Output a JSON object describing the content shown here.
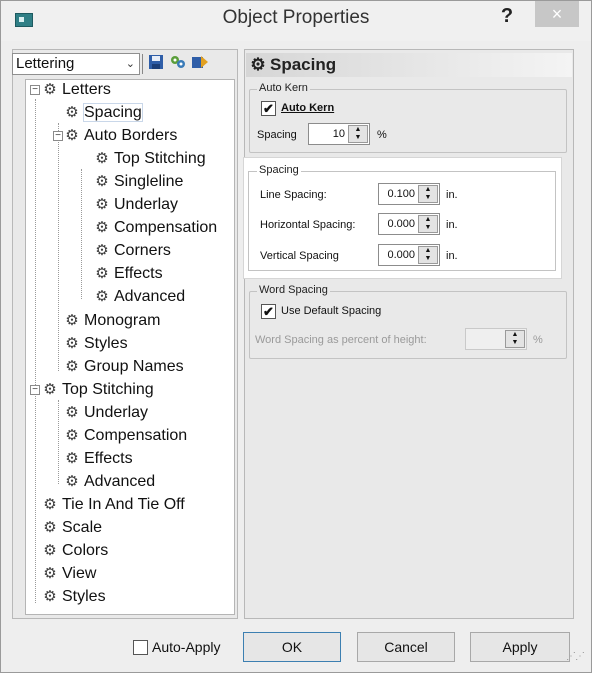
{
  "window": {
    "title": "Object Properties",
    "help_label": "?",
    "close_label": "×"
  },
  "toolbar": {
    "combo_value": "Lettering",
    "combo_arrow": "⌄",
    "tool1_icon": "save-icon",
    "tool2_icon": "gear-group-icon",
    "tool3_icon": "export-icon"
  },
  "tree": {
    "items": [
      {
        "label": "Letters"
      },
      {
        "label": "Spacing"
      },
      {
        "label": "Auto Borders"
      },
      {
        "label": "Top Stitching"
      },
      {
        "label": "Singleline"
      },
      {
        "label": "Underlay"
      },
      {
        "label": "Compensation"
      },
      {
        "label": "Corners"
      },
      {
        "label": "Effects"
      },
      {
        "label": "Advanced"
      },
      {
        "label": "Monogram"
      },
      {
        "label": "Styles"
      },
      {
        "label": "Group Names"
      },
      {
        "label": "Top Stitching"
      },
      {
        "label": "Underlay"
      },
      {
        "label": "Compensation"
      },
      {
        "label": "Effects"
      },
      {
        "label": "Advanced"
      },
      {
        "label": "Tie In And Tie Off"
      },
      {
        "label": "Scale"
      },
      {
        "label": "Colors"
      },
      {
        "label": "View"
      },
      {
        "label": "Styles"
      }
    ]
  },
  "panel": {
    "header": "Spacing",
    "auto_kern": {
      "group_title": "Auto Kern",
      "checkbox_label": "Auto Kern",
      "checked": true,
      "spacing_label": "Spacing",
      "spacing_value": "10",
      "spacing_unit": "%"
    },
    "spacing": {
      "group_title": "Spacing",
      "line_label": "Line Spacing:",
      "line_value": "0.100",
      "horiz_label": "Horizontal Spacing:",
      "horiz_value": "0.000",
      "vert_label": "Vertical Spacing",
      "vert_value": "0.000",
      "unit": "in."
    },
    "word_spacing": {
      "group_title": "Word Spacing",
      "checkbox_label": "Use Default Spacing",
      "checked": true,
      "percent_label": "Word Spacing as percent of height:",
      "percent_value": "",
      "percent_unit": "%"
    }
  },
  "buttons": {
    "auto_apply": "Auto-Apply",
    "ok": "OK",
    "cancel": "Cancel",
    "apply": "Apply"
  },
  "check_mark": "✔"
}
